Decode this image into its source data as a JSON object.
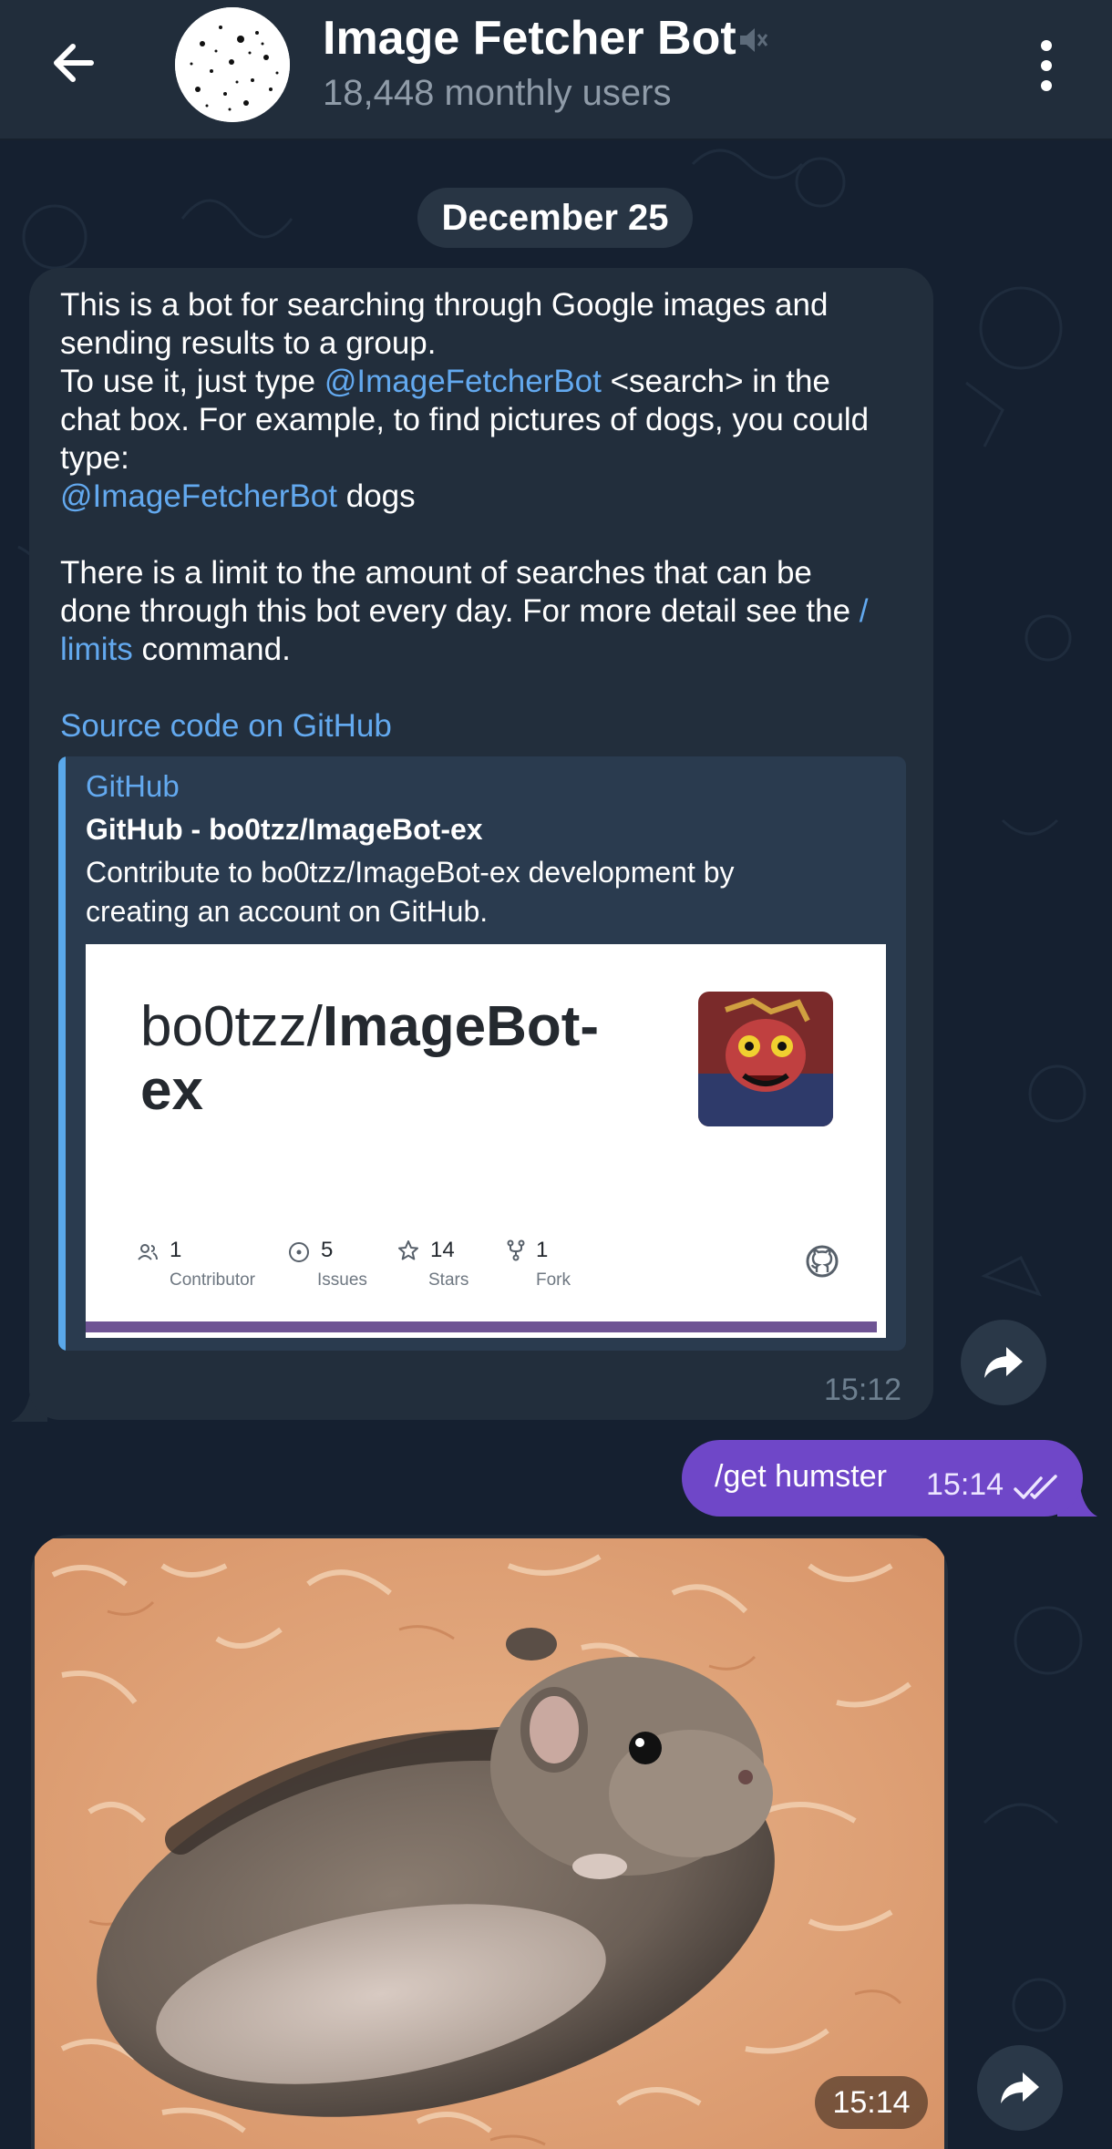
{
  "header": {
    "title": "Image Fetcher Bot",
    "subtitle": "18,448 monthly users"
  },
  "date_separator": "December 25",
  "bot_message": {
    "line1": "This is a bot for searching through Google images and",
    "line2": "sending results to a group.",
    "line3_pre": "To use it, just type ",
    "mention": "@ImageFetcherBot",
    "line3_post": " <search> in the",
    "line4": "chat box. For example, to find pictures of dogs, you could",
    "line5": "type:",
    "line6_post": " dogs",
    "line7": "There is a limit to the amount of searches that can be",
    "line8_pre": "done through this bot every day. For more detail see the ",
    "limits_link_a": "/",
    "limits_link_b": "limits",
    "line9_post": " command.",
    "github_link": "Source code on GitHub",
    "time": "15:12"
  },
  "link_preview": {
    "site": "GitHub",
    "title": "GitHub - bo0tzz/ImageBot-ex",
    "desc_line1": "Contribute to bo0tzz/ImageBot-ex development by",
    "desc_line2": "creating an account on GitHub.",
    "card": {
      "owner": "bo0tzz/",
      "repo_a": "ImageBot-",
      "repo_b": "ex",
      "stats": [
        {
          "num": "1",
          "label": "Contributor",
          "icon": "people-icon"
        },
        {
          "num": "5",
          "label": "Issues",
          "icon": "issue-icon"
        },
        {
          "num": "14",
          "label": "Stars",
          "icon": "star-icon"
        },
        {
          "num": "1",
          "label": "Fork",
          "icon": "fork-icon"
        }
      ]
    }
  },
  "user_message": {
    "text": "/get humster",
    "time": "15:14"
  },
  "photo_message": {
    "time": "15:14"
  },
  "colors": {
    "background": "#152030",
    "header": "#212d3b",
    "incoming_bubble": "#222e3c",
    "outgoing_bubble": "#6f47c8",
    "link": "#63a9ef"
  }
}
